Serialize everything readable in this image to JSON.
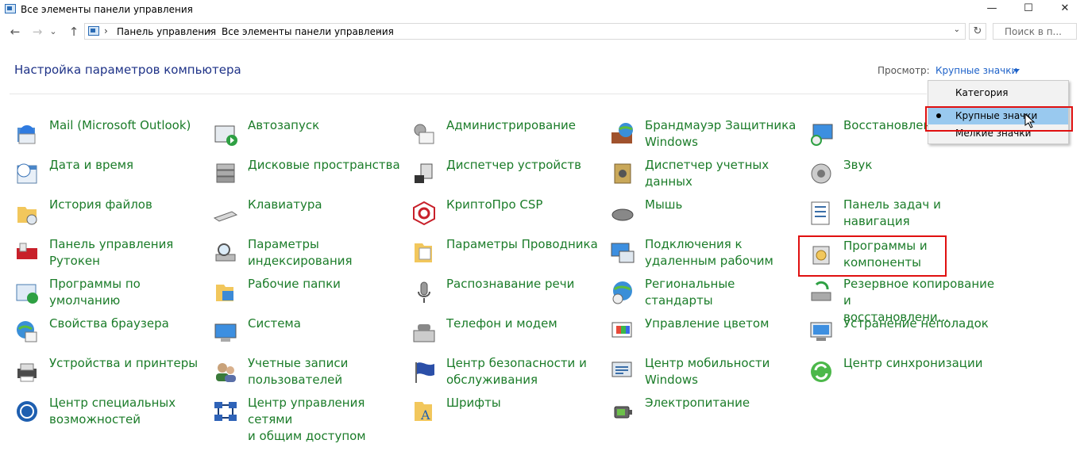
{
  "window": {
    "title": "Все элементы панели управления",
    "minimize": "—",
    "maximize": "☐",
    "close": "✕"
  },
  "nav": {
    "back": "←",
    "forward": "→",
    "recent": "⌄",
    "up": "↑"
  },
  "address": {
    "crumbs": [
      "Панель управления",
      "Все элементы панели управления"
    ],
    "separator": "›",
    "dropdown": "⌄",
    "refresh": "↻"
  },
  "search": {
    "placeholder": "Поиск в п..."
  },
  "main": {
    "heading": "Настройка параметров компьютера"
  },
  "view": {
    "label": "Просмотр:",
    "selected": "Крупные значки",
    "options": [
      "Категория",
      "Крупные значки",
      "Мелкие значки"
    ]
  },
  "colors": {
    "link": "#1b7c29",
    "heading": "#1e3287",
    "accent": "#1e62c9",
    "highlight": "#e01010",
    "selected": "#99c9ef"
  },
  "items": [
    {
      "label": "Mail (Microsoft Outlook)",
      "icon": "mail-icon"
    },
    {
      "label": "Автозапуск",
      "icon": "autoplay-icon"
    },
    {
      "label": "Администрирование",
      "icon": "admin-tools-icon"
    },
    {
      "label": "Брандмауэр Защитника\nWindows",
      "icon": "firewall-icon"
    },
    {
      "label": "Восстановлени",
      "icon": "recovery-icon"
    },
    {
      "label": "Дата и время",
      "icon": "datetime-icon"
    },
    {
      "label": "Дисковые пространства",
      "icon": "storage-spaces-icon"
    },
    {
      "label": "Диспетчер устройств",
      "icon": "device-manager-icon"
    },
    {
      "label": "Диспетчер учетных\nданных",
      "icon": "credential-manager-icon"
    },
    {
      "label": "Звук",
      "icon": "sound-icon"
    },
    {
      "label": "История файлов",
      "icon": "file-history-icon"
    },
    {
      "label": "Клавиатура",
      "icon": "keyboard-icon"
    },
    {
      "label": "КриптоПро CSP",
      "icon": "cryptopro-icon"
    },
    {
      "label": "Мышь",
      "icon": "mouse-icon"
    },
    {
      "label": "Панель задач и\nнавигация",
      "icon": "taskbar-icon"
    },
    {
      "label": "Панель управления\nРутокен",
      "icon": "rutoken-icon"
    },
    {
      "label": "Параметры\nиндексирования",
      "icon": "indexing-icon"
    },
    {
      "label": "Параметры Проводника",
      "icon": "explorer-options-icon"
    },
    {
      "label": "Подключения к\nудаленным рабочим",
      "icon": "remote-desktop-icon"
    },
    {
      "label": "Программы и\nкомпоненты",
      "icon": "programs-features-icon"
    },
    {
      "label": "Программы по\nумолчанию",
      "icon": "default-programs-icon"
    },
    {
      "label": "Рабочие папки",
      "icon": "work-folders-icon"
    },
    {
      "label": "Распознавание речи",
      "icon": "speech-icon"
    },
    {
      "label": "Региональные стандарты",
      "icon": "region-icon"
    },
    {
      "label": "Резервное копирование и\nвосстановлени...",
      "icon": "backup-icon"
    },
    {
      "label": "Свойства браузера",
      "icon": "internet-options-icon"
    },
    {
      "label": "Система",
      "icon": "system-icon"
    },
    {
      "label": "Телефон и модем",
      "icon": "phone-modem-icon"
    },
    {
      "label": "Управление цветом",
      "icon": "color-management-icon"
    },
    {
      "label": "Устранение неполадок",
      "icon": "troubleshooting-icon"
    },
    {
      "label": "Устройства и принтеры",
      "icon": "devices-printers-icon"
    },
    {
      "label": "Учетные записи\nпользователей",
      "icon": "user-accounts-icon"
    },
    {
      "label": "Центр безопасности и\nобслуживания",
      "icon": "security-center-icon"
    },
    {
      "label": "Центр мобильности\nWindows",
      "icon": "mobility-center-icon"
    },
    {
      "label": "Центр синхронизации",
      "icon": "sync-center-icon"
    },
    {
      "label": "Центр специальных\nвозможностей",
      "icon": "ease-of-access-icon"
    },
    {
      "label": "Центр управления сетями\nи общим доступом",
      "icon": "network-center-icon"
    },
    {
      "label": "Шрифты",
      "icon": "fonts-icon"
    },
    {
      "label": "Электропитание",
      "icon": "power-icon"
    }
  ]
}
